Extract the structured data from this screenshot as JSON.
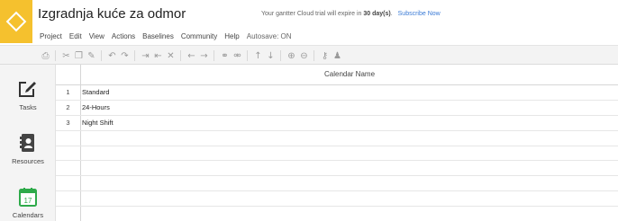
{
  "app": {
    "title": "Izgradnja kuće za odmor",
    "trial_text_prefix": "Your gantter Cloud trial will expire in",
    "trial_days": "30 day(s)",
    "trial_text_suffix": ".",
    "subscribe_label": "Subscribe Now",
    "brand_color": "#f5c12e",
    "link_color": "#3b7bd6"
  },
  "menu": {
    "items": [
      "Project",
      "Edit",
      "View",
      "Actions",
      "Baselines",
      "Community",
      "Help"
    ],
    "autosave": "Autosave: ON"
  },
  "toolbar": {
    "icons": [
      "print-icon",
      "cut-icon",
      "copy-icon",
      "paste-icon",
      "undo-icon",
      "redo-icon",
      "indent-icon",
      "outdent-icon",
      "delete-icon",
      "left-arrow-icon",
      "right-arrow-icon",
      "link-icon",
      "unlink-icon",
      "up-arrow-icon",
      "down-arrow-icon",
      "zoom-in-icon",
      "zoom-out-icon",
      "key-icon",
      "person-icon"
    ]
  },
  "sidebar": {
    "items": [
      {
        "label": "Tasks",
        "icon": "edit-icon"
      },
      {
        "label": "Resources",
        "icon": "contacts-book-icon"
      },
      {
        "label": "Calendars",
        "icon": "calendar-icon",
        "icon_text": "17",
        "active_color": "#2eaa4a"
      }
    ]
  },
  "grid": {
    "column_header": "Calendar Name",
    "rows": [
      {
        "num": "1",
        "name": "Standard"
      },
      {
        "num": "2",
        "name": "24-Hours"
      },
      {
        "num": "3",
        "name": "Night Shift"
      },
      {
        "num": "",
        "name": ""
      },
      {
        "num": "",
        "name": ""
      },
      {
        "num": "",
        "name": ""
      },
      {
        "num": "",
        "name": ""
      },
      {
        "num": "",
        "name": ""
      },
      {
        "num": "",
        "name": ""
      }
    ]
  }
}
